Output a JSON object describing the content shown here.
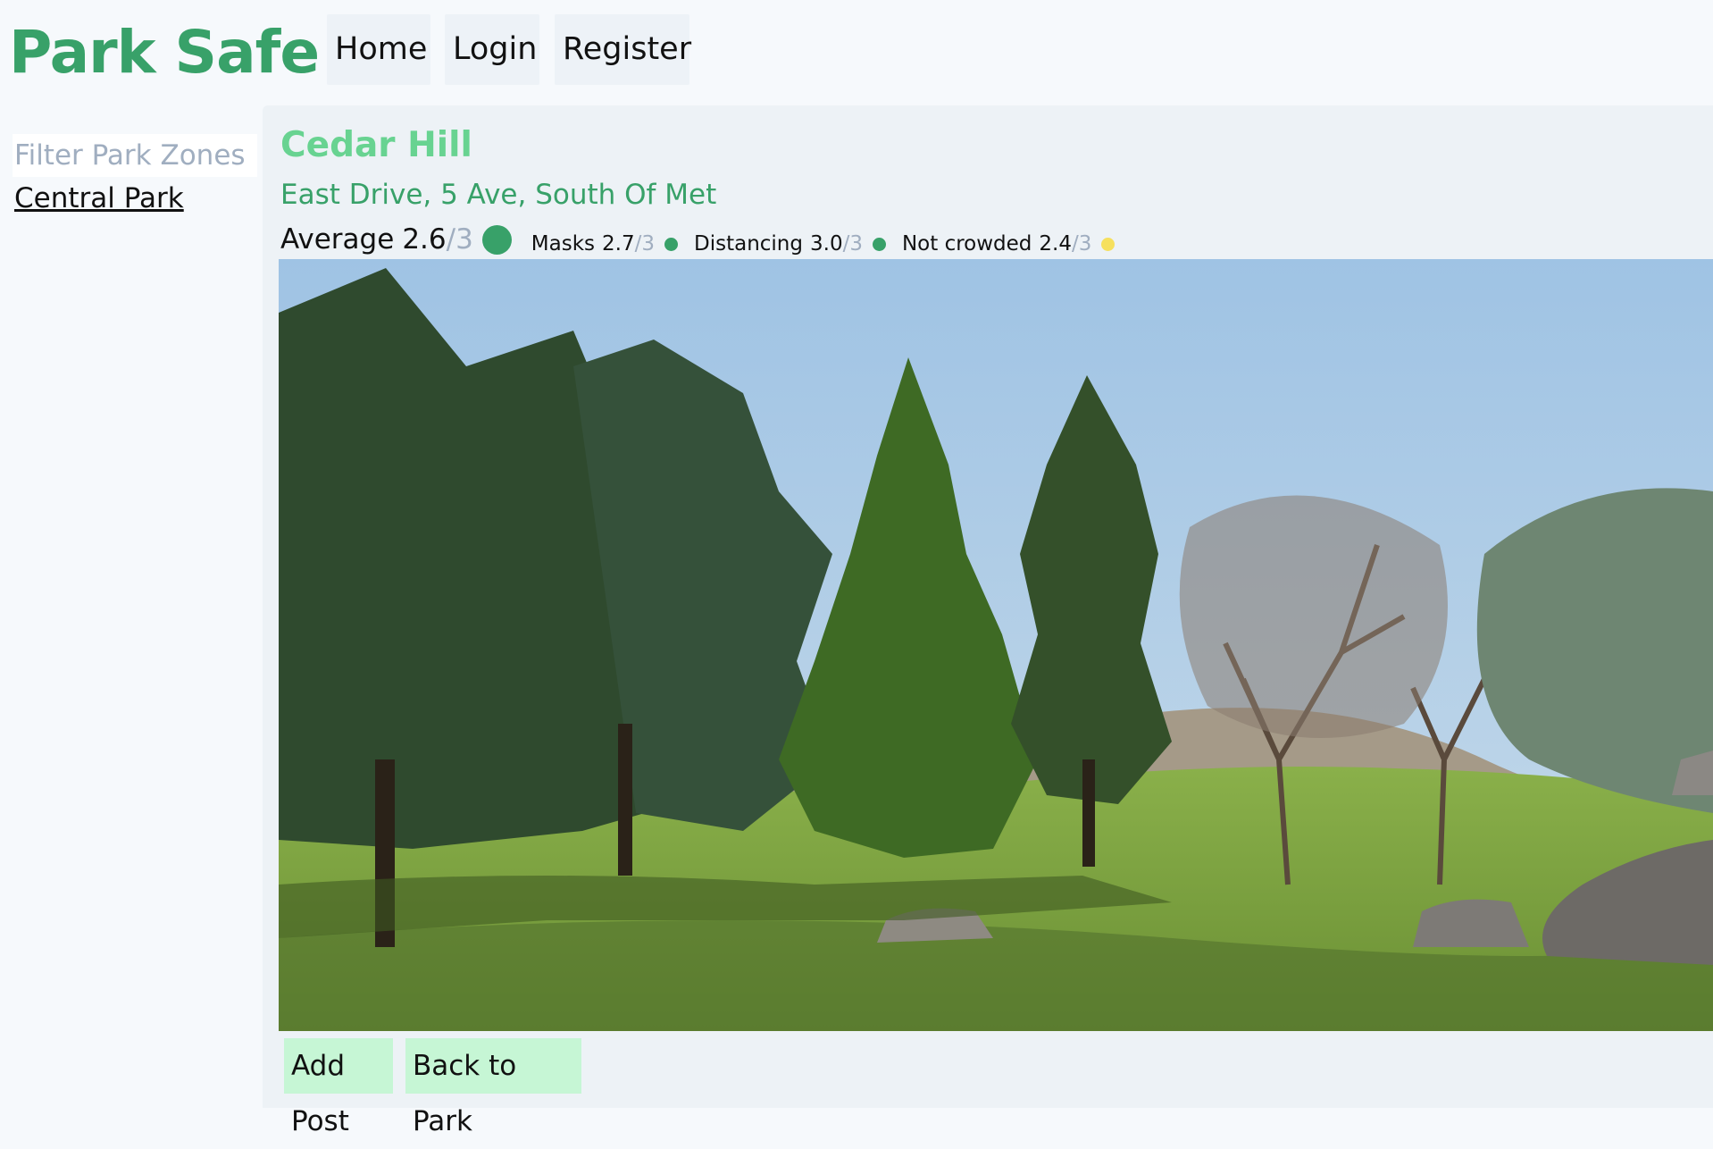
{
  "header": {
    "brand": "Park Safe",
    "nav": {
      "home": "Home",
      "login": "Login",
      "register": "Register"
    }
  },
  "sidebar": {
    "filter_placeholder": "Filter Park Zones",
    "parks": [
      "Central Park"
    ]
  },
  "zone": {
    "name": "Cedar Hill",
    "address": "East Drive, 5 Ave, South Of Met",
    "ratings": {
      "average_label": "Average",
      "average_value": "2.6",
      "out_of": "/3",
      "average_color": "#38a169",
      "metrics": [
        {
          "label": "Masks",
          "value": "2.7",
          "color": "#38a169"
        },
        {
          "label": "Distancing",
          "value": "3.0",
          "color": "#38a169"
        },
        {
          "label": "Not crowded",
          "value": "2.4",
          "color": "#f6e05e"
        }
      ]
    },
    "photo_icon": "park-photo"
  },
  "actions": {
    "add_post": "Add Post",
    "back_to_park": "Back to Park"
  },
  "colors": {
    "brand_green": "#38a169",
    "title_green": "#68d391",
    "button_green": "#c6f6d5",
    "nav_gray": "#edf2f7",
    "muted": "#a0aec0"
  }
}
